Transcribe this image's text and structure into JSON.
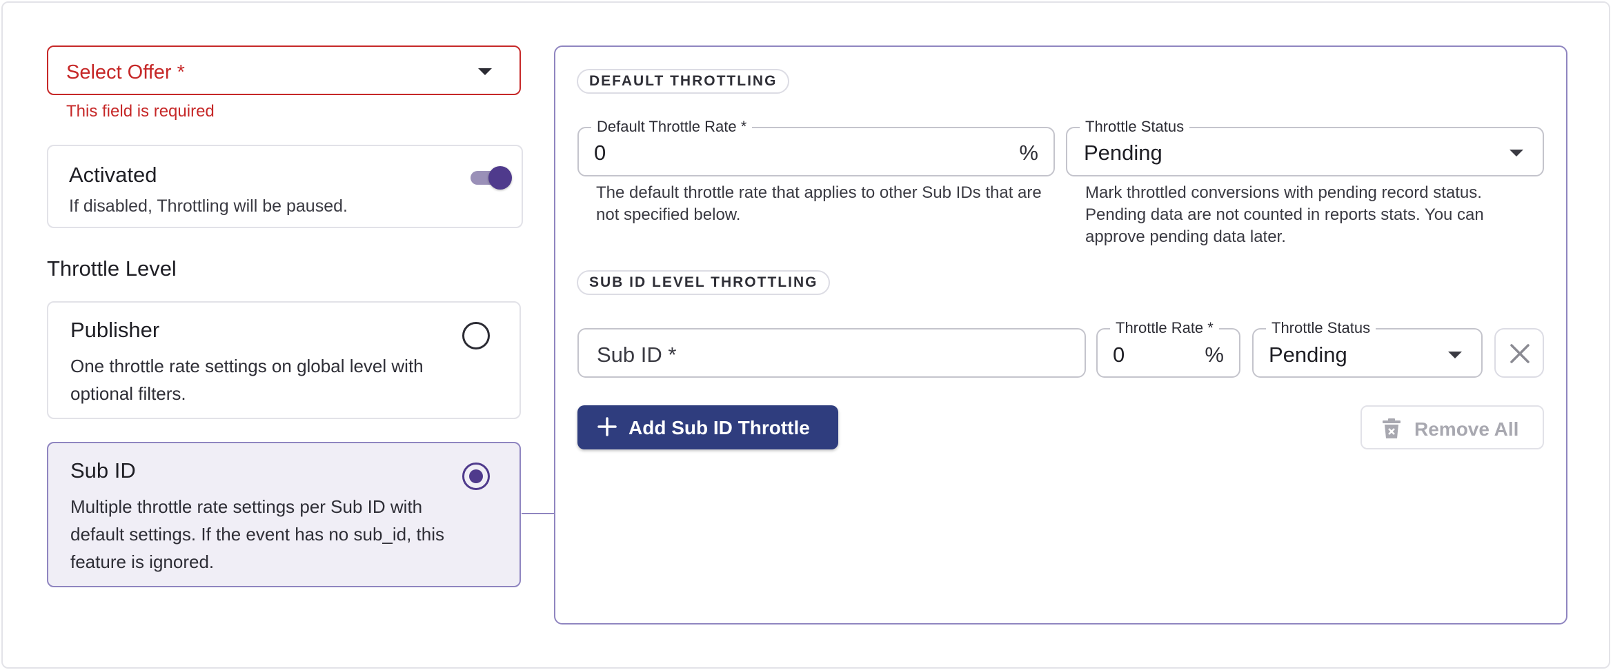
{
  "offer_select": {
    "label": "Select Offer *",
    "error": "This field is required"
  },
  "activated": {
    "title": "Activated",
    "description": "If disabled, Throttling will be paused.",
    "enabled": true
  },
  "throttle_level": {
    "heading": "Throttle Level",
    "options": [
      {
        "title": "Publisher",
        "description": "One throttle rate settings on global level with optional filters.",
        "selected": false
      },
      {
        "title": "Sub ID",
        "description": "Multiple throttle rate settings per Sub ID with default settings. If the event has no sub_id, this feature is ignored.",
        "selected": true
      }
    ]
  },
  "default_throttling": {
    "section_label": "DEFAULT THROTTLING",
    "rate_label": "Default Throttle Rate *",
    "rate_value": "0",
    "rate_unit": "%",
    "rate_helper": "The default throttle rate that applies to other Sub IDs that are not specified below.",
    "status_label": "Throttle Status",
    "status_value": "Pending",
    "status_helper": "Mark throttled conversions with pending record status. Pending data are not counted in reports stats. You can approve pending data later."
  },
  "sub_id_throttling": {
    "section_label": "SUB ID LEVEL THROTTLING",
    "rows": [
      {
        "sub_id_placeholder": "Sub ID *",
        "rate_label": "Throttle Rate *",
        "rate_value": "0",
        "rate_unit": "%",
        "status_label": "Throttle Status",
        "status_value": "Pending"
      }
    ],
    "add_button": "Add Sub ID Throttle",
    "remove_all_button": "Remove All"
  },
  "colors": {
    "error": "#c62828",
    "accent": "#4f3a8c",
    "primary_button": "#2f3d7e",
    "selected_card_bg": "#f0eef6"
  }
}
